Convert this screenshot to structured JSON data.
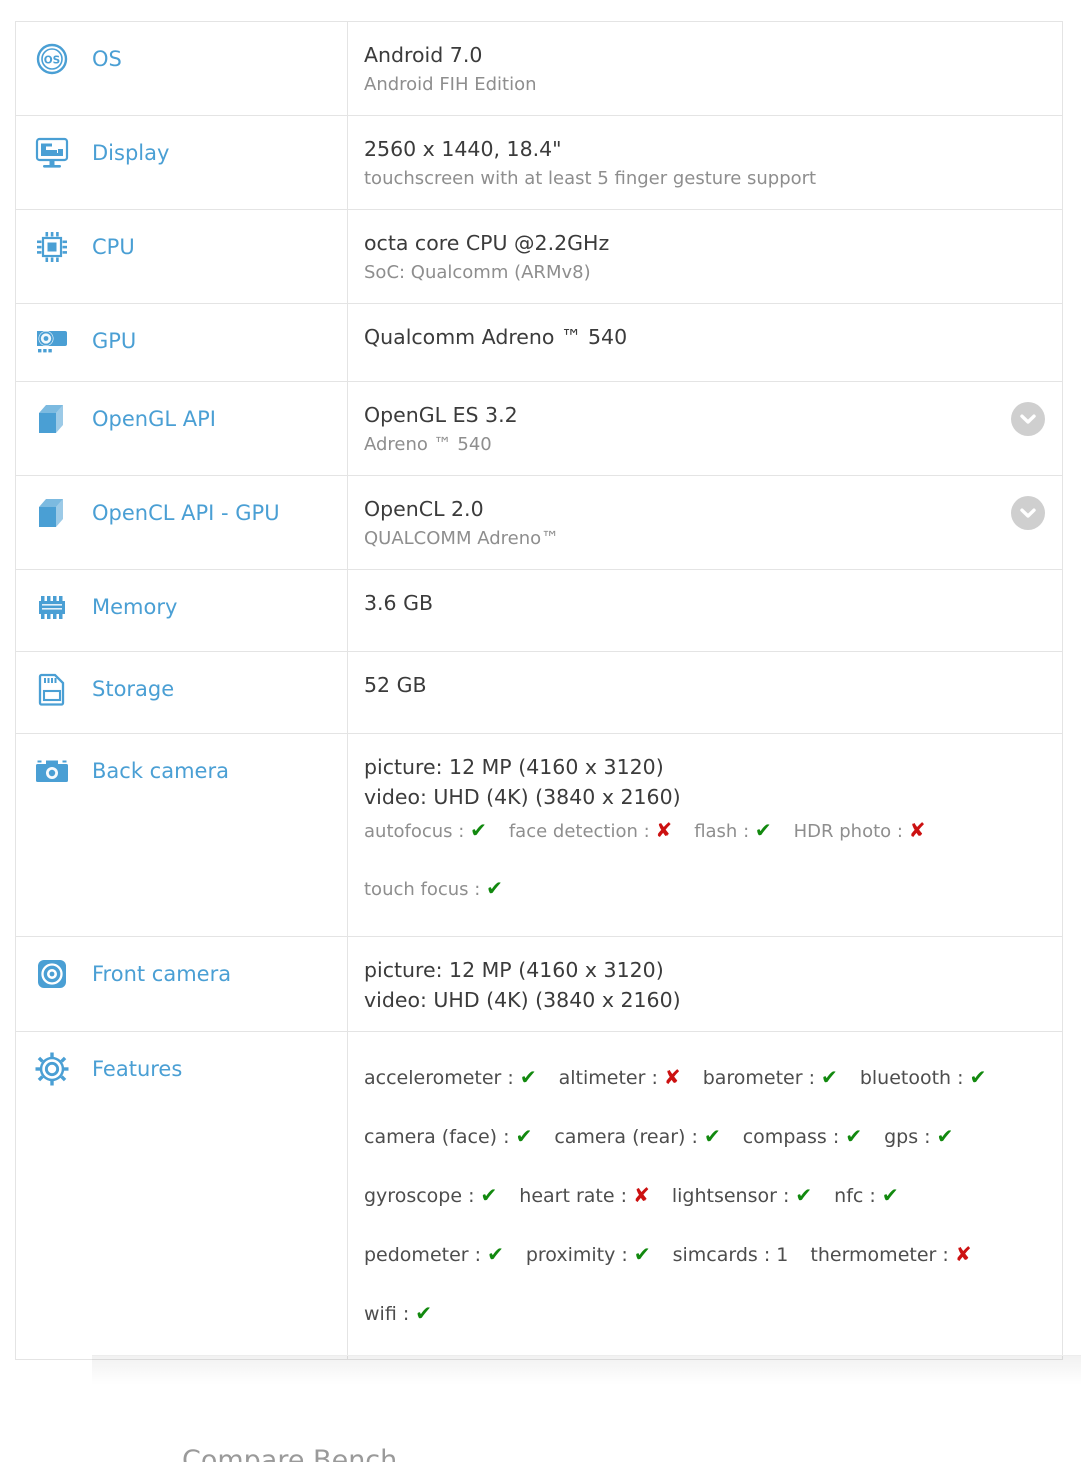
{
  "accent": "#4a9fd4",
  "yes_color": "#12890f",
  "no_color": "#cc1111",
  "expander_color": "#cfcfcf",
  "table": {
    "rows": [
      {
        "key": "os",
        "icon": "os-disc-icon",
        "label": "OS",
        "main": "Android 7.0",
        "sub": "Android FIH Edition",
        "expander": false
      },
      {
        "key": "display",
        "icon": "monitor-icon",
        "label": "Display",
        "main": "2560 x 1440, 18.4\"",
        "sub": "touchscreen with at least 5 finger gesture support",
        "expander": false
      },
      {
        "key": "cpu",
        "icon": "cpu-chip-icon",
        "label": "CPU",
        "main": "octa core CPU @2.2GHz",
        "sub": "SoC: Qualcomm (ARMv8)",
        "expander": false
      },
      {
        "key": "gpu",
        "icon": "gpu-card-icon",
        "label": "GPU",
        "main": "Qualcomm Adreno ™ 540",
        "sub": "",
        "expander": false
      },
      {
        "key": "opengl",
        "icon": "cube-icon",
        "label": "OpenGL API",
        "main": "OpenGL ES 3.2",
        "sub": "Adreno ™ 540",
        "expander": true
      },
      {
        "key": "opencl",
        "icon": "cube-icon",
        "label": "OpenCL API - GPU",
        "main": "OpenCL 2.0",
        "sub": "QUALCOMM Adreno™",
        "expander": true
      },
      {
        "key": "memory",
        "icon": "memory-chip-icon",
        "label": "Memory",
        "main": "3.6 GB",
        "sub": "",
        "expander": false
      },
      {
        "key": "storage",
        "icon": "sd-card-icon",
        "label": "Storage",
        "main": "52 GB",
        "sub": "",
        "expander": false
      },
      {
        "key": "back_camera",
        "icon": "camera-back-icon",
        "label": "Back camera",
        "main": "picture: 12 MP (4160 x 3120)",
        "main2": "video: UHD (4K) (3840 x 2160)",
        "expander": false,
        "flag_rows": [
          [
            {
              "name": "autofocus",
              "value": "yes"
            },
            {
              "name": "face detection",
              "value": "no"
            },
            {
              "name": "flash",
              "value": "yes"
            },
            {
              "name": "HDR photo",
              "value": "no"
            }
          ],
          [
            {
              "name": "touch focus",
              "value": "yes"
            }
          ]
        ]
      },
      {
        "key": "front_camera",
        "icon": "camera-front-icon",
        "label": "Front camera",
        "main": "picture: 12 MP (4160 x 3120)",
        "main2": "video: UHD (4K) (3840 x 2160)",
        "expander": false
      },
      {
        "key": "features",
        "icon": "gear-icon",
        "label": "Features",
        "expander": false,
        "flag_rows": [
          [
            {
              "name": "accelerometer",
              "value": "yes"
            },
            {
              "name": "altimeter",
              "value": "no"
            },
            {
              "name": "barometer",
              "value": "yes"
            },
            {
              "name": "bluetooth",
              "value": "yes"
            }
          ],
          [
            {
              "name": "camera (face)",
              "value": "yes"
            },
            {
              "name": "camera (rear)",
              "value": "yes"
            },
            {
              "name": "compass",
              "value": "yes"
            },
            {
              "name": "gps",
              "value": "yes"
            }
          ],
          [
            {
              "name": "gyroscope",
              "value": "yes"
            },
            {
              "name": "heart rate",
              "value": "no"
            },
            {
              "name": "lightsensor",
              "value": "yes"
            },
            {
              "name": "nfc",
              "value": "yes"
            }
          ],
          [
            {
              "name": "pedometer",
              "value": "yes"
            },
            {
              "name": "proximity",
              "value": "yes"
            },
            {
              "name": "simcards",
              "value": "1"
            },
            {
              "name": "thermometer",
              "value": "no"
            }
          ],
          [
            {
              "name": "wifi",
              "value": "yes"
            }
          ]
        ]
      }
    ]
  },
  "below": {
    "clipped_heading": "Compare Bench"
  }
}
